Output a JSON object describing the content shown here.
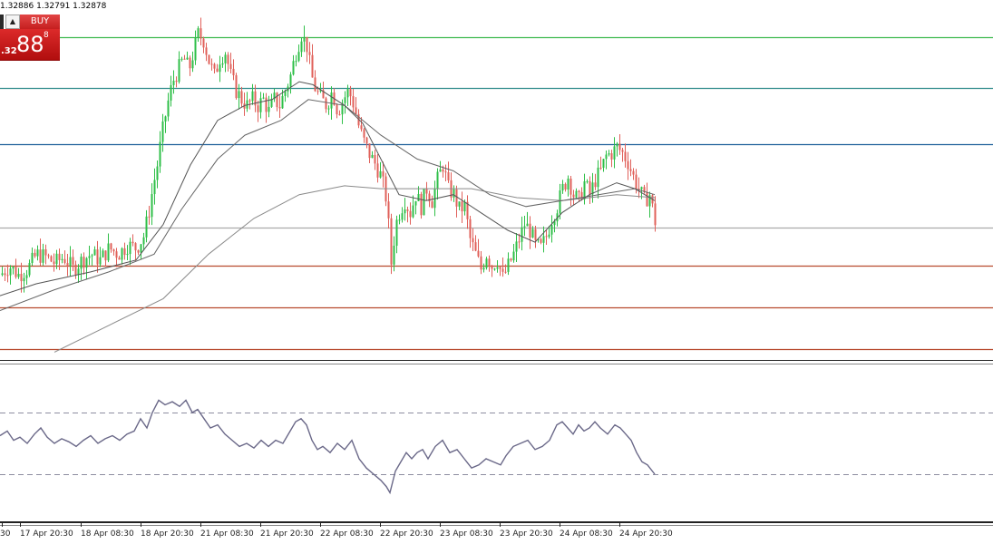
{
  "header": {
    "ohlc": "1.32886 1.32791 1.32878"
  },
  "trade_panel": {
    "stepper_icon": "up-arrow-icon",
    "buy_label": "BUY",
    "price_prefix": ".32",
    "price_big": "88",
    "price_sup": "8"
  },
  "watermark": "",
  "time_axis": {
    "labels": [
      "30",
      "17 Apr 20:30",
      "18 Apr 08:30",
      "18 Apr 20:30",
      "21 Apr 08:30",
      "21 Apr 20:30",
      "22 Apr 08:30",
      "22 Apr 20:30",
      "23 Apr 08:30",
      "23 Apr 20:30",
      "24 Apr 08:30",
      "24 Apr 20:30"
    ]
  },
  "colors": {
    "bull": "#2fbf48",
    "bear": "#e0605a",
    "green_line": "#3fb94f",
    "teal_line": "#2e8b8b",
    "blue_line": "#1f5f9a",
    "red_line": "#b84a2e",
    "gray_line": "#aaaaaa",
    "ma_fast": "#555555",
    "ma_mid": "#666666",
    "ma_slow": "#8a8a8a",
    "osc_line": "#6a6888",
    "osc_levels": "#8d8da0"
  },
  "chart_data": {
    "type": "candlestick",
    "price_scale": {
      "top": 1.338,
      "bottom": 1.3265
    },
    "horizontal_levels": [
      {
        "price": 1.3373,
        "color_key": "green_line"
      },
      {
        "price": 1.3356,
        "color_key": "teal_line"
      },
      {
        "price": 1.3337,
        "color_key": "blue_line"
      },
      {
        "price": 1.3309,
        "color_key": "gray_line"
      },
      {
        "price": 1.3296,
        "color_key": "red_line"
      },
      {
        "price": 1.3282,
        "color_key": "red_line"
      },
      {
        "price": 1.3268,
        "color_key": "red_line"
      }
    ],
    "close_path": [
      [
        0,
        1.3293
      ],
      [
        10,
        1.3296
      ],
      [
        20,
        1.3293
      ],
      [
        30,
        1.3295
      ],
      [
        40,
        1.33
      ],
      [
        50,
        1.3299
      ],
      [
        60,
        1.3297
      ],
      [
        70,
        1.3299
      ],
      [
        80,
        1.3295
      ],
      [
        90,
        1.3298
      ],
      [
        100,
        1.33
      ],
      [
        110,
        1.3298
      ],
      [
        120,
        1.3302
      ],
      [
        130,
        1.33
      ],
      [
        140,
        1.3303
      ],
      [
        150,
        1.3302
      ],
      [
        158,
        1.3306
      ],
      [
        163,
        1.3313
      ],
      [
        168,
        1.3322
      ],
      [
        173,
        1.333
      ],
      [
        178,
        1.334
      ],
      [
        184,
        1.335
      ],
      [
        190,
        1.3358
      ],
      [
        196,
        1.3362
      ],
      [
        202,
        1.3366
      ],
      [
        208,
        1.3362
      ],
      [
        213,
        1.3368
      ],
      [
        218,
        1.3374
      ],
      [
        224,
        1.3372
      ],
      [
        230,
        1.3365
      ],
      [
        236,
        1.336
      ],
      [
        242,
        1.3366
      ],
      [
        248,
        1.3368
      ],
      [
        254,
        1.336
      ],
      [
        260,
        1.3355
      ],
      [
        266,
        1.3352
      ],
      [
        272,
        1.335
      ],
      [
        278,
        1.3352
      ],
      [
        284,
        1.335
      ],
      [
        290,
        1.3352
      ],
      [
        296,
        1.3348
      ],
      [
        302,
        1.3352
      ],
      [
        308,
        1.335
      ],
      [
        314,
        1.3355
      ],
      [
        320,
        1.336
      ],
      [
        326,
        1.3368
      ],
      [
        332,
        1.3374
      ],
      [
        338,
        1.337
      ],
      [
        343,
        1.336
      ],
      [
        348,
        1.3355
      ],
      [
        354,
        1.3352
      ],
      [
        360,
        1.335
      ],
      [
        366,
        1.3355
      ],
      [
        372,
        1.3348
      ],
      [
        378,
        1.3352
      ],
      [
        384,
        1.3355
      ],
      [
        390,
        1.335
      ],
      [
        396,
        1.3342
      ],
      [
        402,
        1.3337
      ],
      [
        408,
        1.3333
      ],
      [
        414,
        1.333
      ],
      [
        420,
        1.3326
      ],
      [
        426,
        1.3318
      ],
      [
        431,
        1.3297
      ],
      [
        436,
        1.331
      ],
      [
        441,
        1.3315
      ],
      [
        446,
        1.3318
      ],
      [
        452,
        1.3314
      ],
      [
        458,
        1.332
      ],
      [
        464,
        1.3316
      ],
      [
        470,
        1.3322
      ],
      [
        476,
        1.3318
      ],
      [
        482,
        1.3325
      ],
      [
        488,
        1.333
      ],
      [
        494,
        1.3322
      ],
      [
        500,
        1.332
      ],
      [
        506,
        1.3315
      ],
      [
        512,
        1.3316
      ],
      [
        518,
        1.3305
      ],
      [
        524,
        1.33
      ],
      [
        530,
        1.3295
      ],
      [
        536,
        1.33
      ],
      [
        542,
        1.3296
      ],
      [
        548,
        1.3298
      ],
      [
        554,
        1.3292
      ],
      [
        560,
        1.3296
      ],
      [
        566,
        1.33
      ],
      [
        572,
        1.3305
      ],
      [
        578,
        1.331
      ],
      [
        584,
        1.3308
      ],
      [
        590,
        1.3303
      ],
      [
        596,
        1.3302
      ],
      [
        602,
        1.3306
      ],
      [
        608,
        1.3312
      ],
      [
        614,
        1.3316
      ],
      [
        620,
        1.3322
      ],
      [
        626,
        1.3326
      ],
      [
        632,
        1.332
      ],
      [
        638,
        1.3318
      ],
      [
        644,
        1.3324
      ],
      [
        650,
        1.332
      ],
      [
        656,
        1.3325
      ],
      [
        662,
        1.3328
      ],
      [
        668,
        1.3333
      ],
      [
        674,
        1.3334
      ],
      [
        680,
        1.3336
      ],
      [
        686,
        1.3334
      ],
      [
        692,
        1.3331
      ],
      [
        698,
        1.3326
      ],
      [
        704,
        1.3322
      ],
      [
        710,
        1.3318
      ],
      [
        716,
        1.332
      ],
      [
        722,
        1.3311
      ]
    ],
    "ma_fast": [
      [
        0,
        1.3286
      ],
      [
        40,
        1.329
      ],
      [
        100,
        1.3294
      ],
      [
        150,
        1.3298
      ],
      [
        180,
        1.331
      ],
      [
        210,
        1.333
      ],
      [
        240,
        1.3345
      ],
      [
        270,
        1.335
      ],
      [
        300,
        1.3352
      ],
      [
        330,
        1.3358
      ],
      [
        345,
        1.3357
      ],
      [
        380,
        1.335
      ],
      [
        400,
        1.3344
      ],
      [
        420,
        1.3332
      ],
      [
        440,
        1.332
      ],
      [
        470,
        1.3318
      ],
      [
        500,
        1.332
      ],
      [
        530,
        1.3314
      ],
      [
        560,
        1.3308
      ],
      [
        590,
        1.3304
      ],
      [
        620,
        1.3314
      ],
      [
        650,
        1.332
      ],
      [
        680,
        1.3324
      ],
      [
        700,
        1.3322
      ],
      [
        722,
        1.3318
      ]
    ],
    "ma_mid": [
      [
        0,
        1.3281
      ],
      [
        60,
        1.3288
      ],
      [
        120,
        1.3294
      ],
      [
        170,
        1.33
      ],
      [
        200,
        1.3315
      ],
      [
        240,
        1.3332
      ],
      [
        270,
        1.334
      ],
      [
        310,
        1.3345
      ],
      [
        340,
        1.3352
      ],
      [
        380,
        1.335
      ],
      [
        420,
        1.334
      ],
      [
        460,
        1.3332
      ],
      [
        500,
        1.3328
      ],
      [
        540,
        1.332
      ],
      [
        580,
        1.3316
      ],
      [
        620,
        1.3318
      ],
      [
        660,
        1.332
      ],
      [
        700,
        1.3322
      ],
      [
        722,
        1.332
      ]
    ],
    "ma_slow": [
      [
        60,
        1.3267
      ],
      [
        120,
        1.3276
      ],
      [
        180,
        1.3285
      ],
      [
        230,
        1.33
      ],
      [
        280,
        1.3312
      ],
      [
        330,
        1.332
      ],
      [
        380,
        1.3323
      ],
      [
        420,
        1.3322
      ],
      [
        470,
        1.3322
      ],
      [
        520,
        1.3322
      ],
      [
        570,
        1.3319
      ],
      [
        620,
        1.3318
      ],
      [
        680,
        1.332
      ],
      [
        722,
        1.3319
      ]
    ],
    "oscillator": {
      "upper_level": 70,
      "lower_level": 30,
      "values": [
        [
          0,
          55
        ],
        [
          8,
          58
        ],
        [
          15,
          52
        ],
        [
          22,
          54
        ],
        [
          30,
          50
        ],
        [
          38,
          56
        ],
        [
          45,
          60
        ],
        [
          52,
          54
        ],
        [
          60,
          50
        ],
        [
          68,
          53
        ],
        [
          76,
          51
        ],
        [
          84,
          48
        ],
        [
          92,
          52
        ],
        [
          100,
          55
        ],
        [
          108,
          50
        ],
        [
          116,
          53
        ],
        [
          124,
          55
        ],
        [
          132,
          52
        ],
        [
          140,
          56
        ],
        [
          148,
          58
        ],
        [
          155,
          66
        ],
        [
          162,
          60
        ],
        [
          168,
          70
        ],
        [
          175,
          78
        ],
        [
          182,
          75
        ],
        [
          190,
          77
        ],
        [
          198,
          74
        ],
        [
          205,
          78
        ],
        [
          212,
          70
        ],
        [
          218,
          72
        ],
        [
          225,
          66
        ],
        [
          232,
          60
        ],
        [
          240,
          62
        ],
        [
          248,
          56
        ],
        [
          256,
          52
        ],
        [
          264,
          48
        ],
        [
          272,
          50
        ],
        [
          280,
          47
        ],
        [
          288,
          52
        ],
        [
          296,
          48
        ],
        [
          304,
          52
        ],
        [
          312,
          50
        ],
        [
          320,
          58
        ],
        [
          326,
          64
        ],
        [
          332,
          66
        ],
        [
          338,
          62
        ],
        [
          344,
          52
        ],
        [
          350,
          46
        ],
        [
          356,
          48
        ],
        [
          364,
          44
        ],
        [
          372,
          50
        ],
        [
          380,
          46
        ],
        [
          388,
          52
        ],
        [
          396,
          40
        ],
        [
          404,
          34
        ],
        [
          412,
          30
        ],
        [
          420,
          26
        ],
        [
          426,
          22
        ],
        [
          430,
          18
        ],
        [
          436,
          32
        ],
        [
          442,
          38
        ],
        [
          448,
          44
        ],
        [
          454,
          40
        ],
        [
          460,
          44
        ],
        [
          466,
          46
        ],
        [
          472,
          40
        ],
        [
          480,
          48
        ],
        [
          488,
          52
        ],
        [
          496,
          44
        ],
        [
          504,
          46
        ],
        [
          512,
          40
        ],
        [
          520,
          34
        ],
        [
          528,
          36
        ],
        [
          536,
          40
        ],
        [
          544,
          38
        ],
        [
          552,
          36
        ],
        [
          558,
          42
        ],
        [
          566,
          48
        ],
        [
          574,
          50
        ],
        [
          582,
          52
        ],
        [
          590,
          46
        ],
        [
          598,
          48
        ],
        [
          606,
          52
        ],
        [
          614,
          62
        ],
        [
          620,
          64
        ],
        [
          626,
          60
        ],
        [
          632,
          56
        ],
        [
          638,
          62
        ],
        [
          644,
          58
        ],
        [
          650,
          60
        ],
        [
          656,
          64
        ],
        [
          662,
          60
        ],
        [
          670,
          56
        ],
        [
          678,
          62
        ],
        [
          684,
          60
        ],
        [
          690,
          56
        ],
        [
          696,
          52
        ],
        [
          702,
          44
        ],
        [
          708,
          38
        ],
        [
          714,
          36
        ],
        [
          722,
          30
        ]
      ]
    }
  }
}
